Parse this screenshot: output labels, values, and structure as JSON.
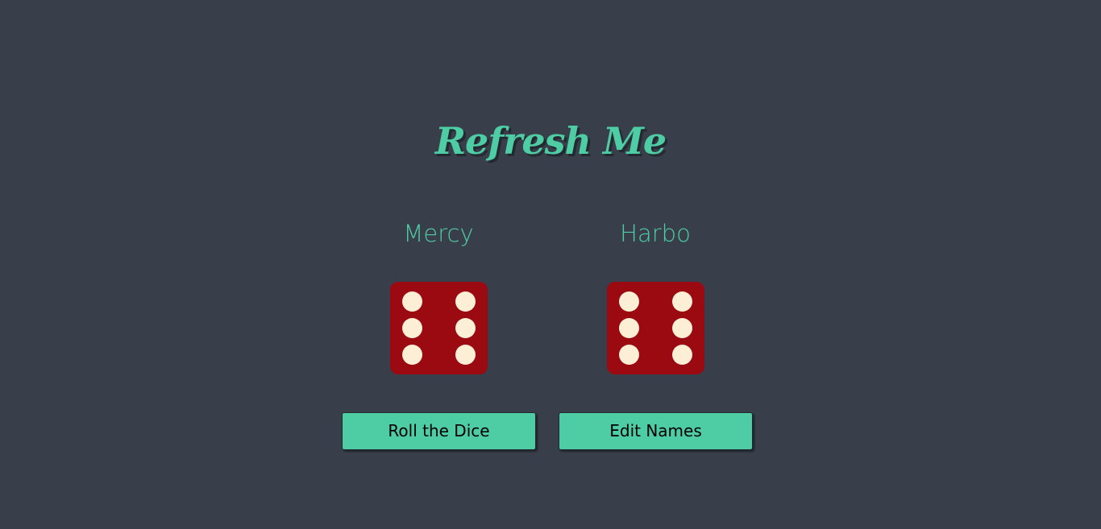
{
  "title": "Refresh Me",
  "players": [
    {
      "name": "Mercy",
      "die_value": 6
    },
    {
      "name": "Harbo",
      "die_value": 6
    }
  ],
  "buttons": {
    "roll_label": "Roll the Dice",
    "edit_label": "Edit Names"
  },
  "colors": {
    "background": "#393f4a",
    "accent": "#4ecca3",
    "die": "#9a0a10",
    "pip": "#fcefd6"
  }
}
